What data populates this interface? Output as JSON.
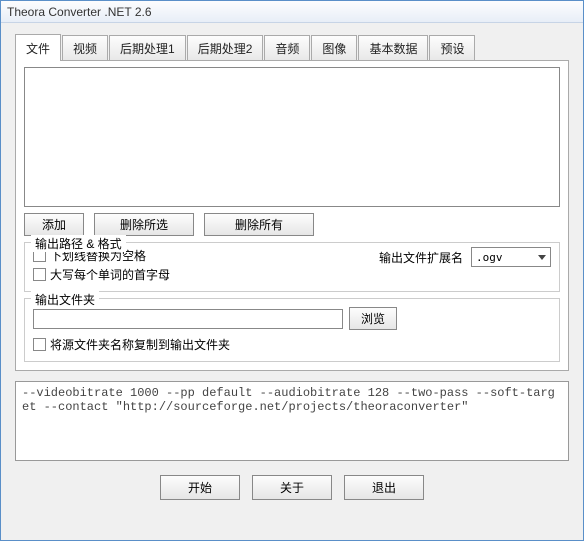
{
  "window": {
    "title": "Theora Converter .NET 2.6"
  },
  "tabs": {
    "items": [
      {
        "label": "文件"
      },
      {
        "label": "视频"
      },
      {
        "label": "后期处理1"
      },
      {
        "label": "后期处理2"
      },
      {
        "label": "音频"
      },
      {
        "label": "图像"
      },
      {
        "label": "基本数据"
      },
      {
        "label": "预设"
      }
    ],
    "activeIndex": 0
  },
  "fileButtons": {
    "add": "添加",
    "removeSelected": "删除所选",
    "removeAll": "删除所有"
  },
  "outputFormat": {
    "legend": "输出路径 & 格式",
    "chkUnderscoreToSpace": "下划线替换为空格",
    "chkCapitalize": "大写每个单词的首字母",
    "extLabel": "输出文件扩展名",
    "extValue": ".ogv"
  },
  "outputFolder": {
    "legend": "输出文件夹",
    "pathValue": "",
    "browse": "浏览",
    "chkCopyName": "将源文件夹名称复制到输出文件夹"
  },
  "cmdline": "--videobitrate 1000 --pp default --audiobitrate 128 --two-pass --soft-target --contact \"http://sourceforge.net/projects/theoraconverter\"",
  "bottom": {
    "start": "开始",
    "about": "关于",
    "exit": "退出"
  }
}
